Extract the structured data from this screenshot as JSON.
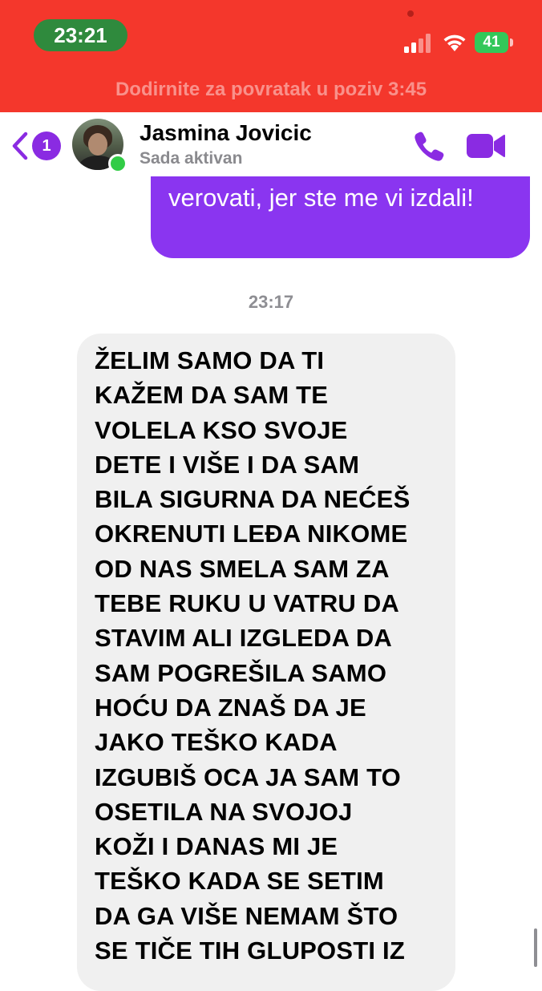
{
  "status_bar": {
    "time": "23:21",
    "battery_level": "41",
    "call_banner_text": "Dodirnite za povratak u poziv 3:45"
  },
  "header": {
    "back_badge_count": "1",
    "contact_name": "Jasmina Jovicic",
    "contact_status": "Sada aktivan"
  },
  "messages": {
    "outgoing": {
      "text": "verovati, jer ste me vi izdali!"
    },
    "timestamp": "23:17",
    "incoming": {
      "text": "ŽELIM SAMO DA TI\nKAŽEM DA SAM TE\nVOLELA KSO SVOJE\nDETE I VIŠE I DA SAM\nBILA SIGURNA DA NEĆEŠ\nOKRENUTI LEĐA NIKOME\nOD NAS SMELA SAM ZA\nTEBE RUKU U VATRU DA\nSTAVIM ALI IZGLEDA DA\nSAM POGREŠILA SAMO\nHOĆU DA ZNAŠ DA JE\nJAKO TEŠKO KADA\nIZGUBIŠ OCA JA SAM TO\nOSETILA NA SVOJOJ\nKOŽI I DANAS MI JE\nTEŠKO KADA SE SETIM\nDA GA VIŠE NEMAM ŠTO\nSE TIČE TIH GLUPOSTI IZ"
    }
  },
  "colors": {
    "status_bar": "#f4372c",
    "time_pill": "#2f8a3d",
    "accent": "#8a35f0",
    "incoming_bubble": "#f0f0f0",
    "online": "#31cc46",
    "battery": "#33c759"
  },
  "icons": {
    "back": "chevron-left-icon",
    "call": "phone-icon",
    "video": "video-camera-icon",
    "signal": "cellular-signal-icon",
    "wifi": "wifi-icon",
    "battery": "battery-icon"
  }
}
